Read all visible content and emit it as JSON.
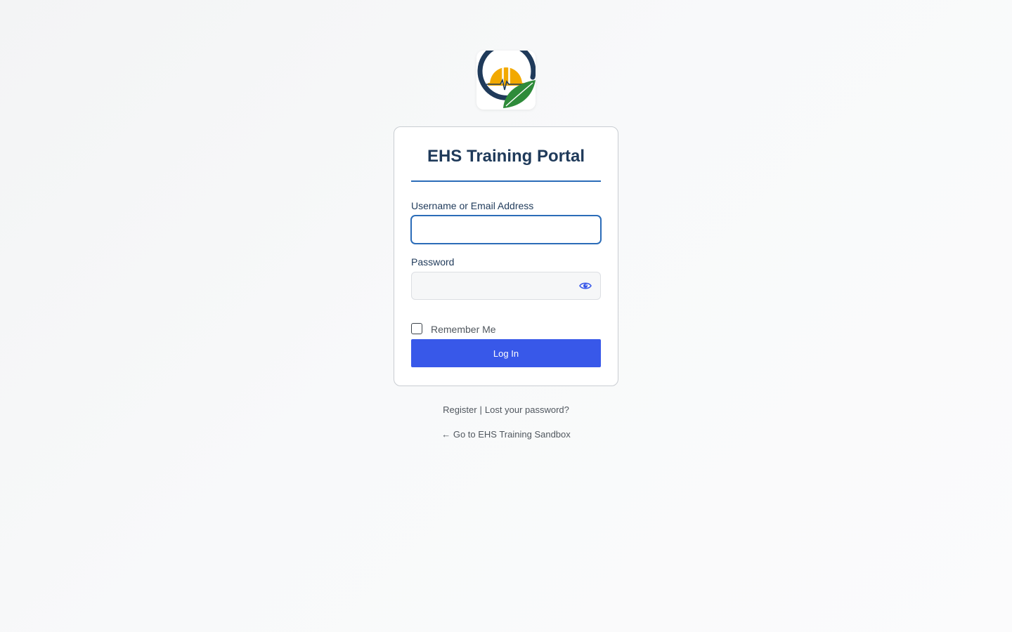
{
  "logo": {
    "icon": "ehs-logo-icon",
    "colors": {
      "ring": "#1f3a5a",
      "helmet": "#f2a900",
      "leaf": "#2e8b3a"
    }
  },
  "card": {
    "title": "EHS Training Portal",
    "username_label": "Username or Email Address",
    "username_value": "",
    "password_label": "Password",
    "password_value": "",
    "remember_label": "Remember Me",
    "login_label": "Log In"
  },
  "links": {
    "register": "Register",
    "separator": "|",
    "lost_password": "Lost your password?",
    "back": "← Go to EHS Training Sandbox"
  },
  "colors": {
    "accent": "#3858e9",
    "title": "#1f3a5a",
    "focus": "#2b6cb8"
  }
}
